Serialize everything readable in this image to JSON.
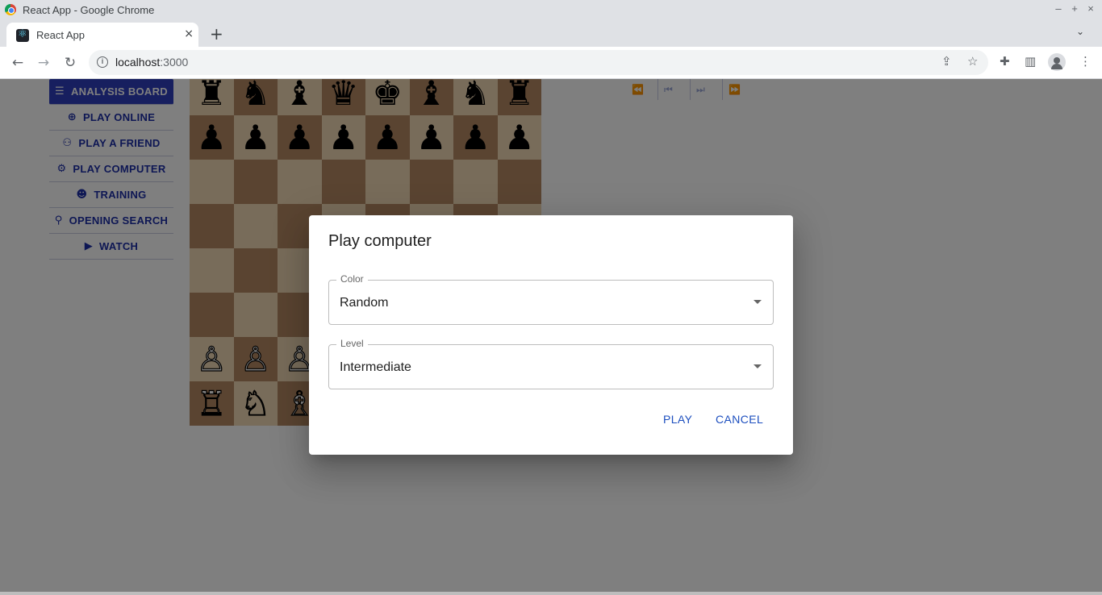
{
  "window": {
    "title": "React App - Google Chrome",
    "controls": [
      "–",
      "+",
      "×"
    ]
  },
  "tabs": [
    {
      "title": "React App",
      "close": "×"
    }
  ],
  "tabstrip": {
    "new_tab": "+",
    "menu": "⌄"
  },
  "toolbar": {
    "url_host": "localhost",
    "url_port": ":3000",
    "back": "←",
    "forward": "→",
    "reload": "↻",
    "share": "⇪",
    "star": "☆",
    "extensions": "✚",
    "sidepanel": "▥",
    "menu": "⋮"
  },
  "sidebar": {
    "items": [
      {
        "label": "ANALYSIS BOARD",
        "icon": "☰",
        "icon_name": "tune-icon",
        "active": true
      },
      {
        "label": "PLAY ONLINE",
        "icon": "⊕",
        "icon_name": "globe-icon"
      },
      {
        "label": "PLAY A FRIEND",
        "icon": "⚇",
        "icon_name": "add-friend-icon"
      },
      {
        "label": "PLAY COMPUTER",
        "icon": "⚙",
        "icon_name": "robot-icon"
      },
      {
        "label": "TRAINING",
        "icon": "☻",
        "icon_name": "brain-icon"
      },
      {
        "label": "OPENING SEARCH",
        "icon": "⚲",
        "icon_name": "search-icon"
      },
      {
        "label": "WATCH",
        "icon": "▶",
        "icon_name": "tv-icon"
      }
    ]
  },
  "board": {
    "rows": [
      [
        "♜",
        "♞",
        "♝",
        "♛",
        "♚",
        "♝",
        "♞",
        "♜"
      ],
      [
        "♟",
        "♟",
        "♟",
        "♟",
        "♟",
        "♟",
        "♟",
        "♟"
      ],
      [
        "",
        "",
        "",
        "",
        "",
        "",
        "",
        ""
      ],
      [
        "",
        "",
        "",
        "",
        "",
        "",
        "",
        ""
      ],
      [
        "",
        "",
        "",
        "",
        "",
        "",
        "",
        ""
      ],
      [
        "",
        "",
        "",
        "",
        "",
        "",
        "",
        ""
      ],
      [
        "♙",
        "♙",
        "♙",
        "♙",
        "♙",
        "♙",
        "♙",
        "♙"
      ],
      [
        "♖",
        "♘",
        "♗",
        "♕",
        "♔",
        "♗",
        "♘",
        "♖"
      ]
    ]
  },
  "move_controls": [
    "⏪",
    "⏮",
    "⏭",
    "⏩"
  ],
  "dialog": {
    "title": "Play computer",
    "color": {
      "label": "Color",
      "value": "Random"
    },
    "level": {
      "label": "Level",
      "value": "Intermediate"
    },
    "play_label": "PLAY",
    "cancel_label": "CANCEL"
  },
  "colors": {
    "accent": "#2f3fbf",
    "board_light": "#f0d9b5",
    "board_dark": "#b58863",
    "button_text": "#1d4fbf"
  }
}
